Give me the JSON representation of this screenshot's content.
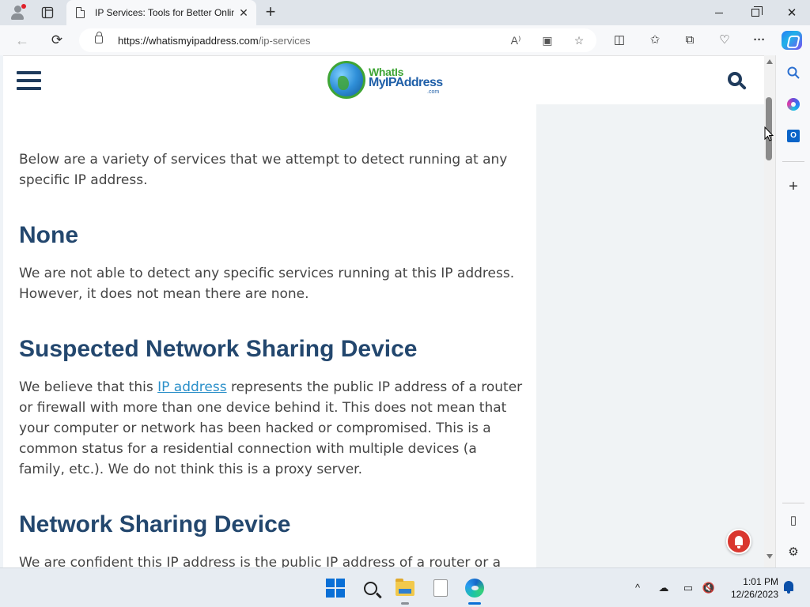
{
  "browser": {
    "tab": {
      "title": "IP Services: Tools for Better Onlin",
      "close_glyph": "✕",
      "favicon_icon": "page-icon"
    },
    "newtab_glyph": "+",
    "window_controls": {
      "close_glyph": "✕"
    },
    "address": {
      "url_host": "https://whatismyipaddress.com",
      "url_path": "/ip-services"
    },
    "nav": {
      "back_glyph": "←",
      "refresh_glyph": "⟳"
    },
    "url_icons": {
      "read_aloud": "A⁾",
      "immersive": "▣",
      "favorite": "☆"
    },
    "toolbar": {
      "split": "◫",
      "favorites": "✩",
      "collections": "⧉",
      "performance": "♡",
      "more": "···"
    }
  },
  "site": {
    "logo": {
      "line1": "WhatIs",
      "line2": "MyIPAddress",
      "line3": ".com"
    }
  },
  "content": {
    "intro": "Below are a variety of services that we attempt to detect running at any specific IP address.",
    "sections": [
      {
        "heading": "None",
        "body": "We are not able to detect any specific services running at this IP address. However, it does not mean there are none."
      },
      {
        "heading": "Suspected Network Sharing Device",
        "body_pre": "We believe that this ",
        "link": "IP address",
        "body_post": " represents the public IP address of a router or firewall with more than one device behind it. This does not mean that your computer or network has been hacked or compromised. This is a common status for a residential connection with multiple devices (a family, etc.). We do not think this is a proxy server."
      },
      {
        "heading": "Network Sharing Device",
        "body": "We are confident this IP address is the public IP address of a router or a"
      }
    ]
  },
  "edge_sidebar": {
    "search": "⌕",
    "add": "+",
    "outlook_letter": "O",
    "sidebar_toggle": "▯",
    "settings": "⚙"
  },
  "taskbar": {
    "tray": {
      "chevron": "^",
      "cloud": "☁",
      "network": "▭",
      "sound": "🔇"
    },
    "clock": {
      "time": "1:01 PM",
      "date": "12/26/2023"
    }
  }
}
